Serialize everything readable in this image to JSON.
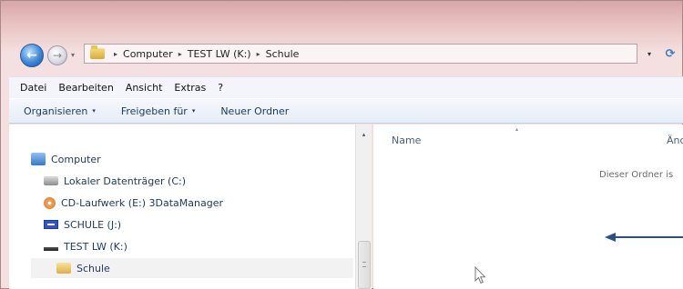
{
  "navigation": {
    "back_label": "←",
    "forward_label": "→",
    "recent_label": "▾",
    "refresh_label": "⟳",
    "dropdown_label": "▾",
    "path": [
      "Computer",
      "TEST LW (K:)",
      "Schule"
    ],
    "separator": "▸"
  },
  "menu": {
    "items": [
      "Datei",
      "Bearbeiten",
      "Ansicht",
      "Extras",
      "?"
    ]
  },
  "commands": {
    "organize": "Organisieren",
    "share": "Freigeben für",
    "new_folder": "Neuer Ordner",
    "caret": "▾"
  },
  "tree": {
    "computer": "Computer",
    "local_disk": "Lokaler Datenträger (C:)",
    "cd_drive": "CD-Laufwerk (E:) 3DataManager",
    "schule_drive": "SCHULE (J:)",
    "test_drive": "TEST LW (K:)",
    "schule_folder": "Schule"
  },
  "content": {
    "col_name": "Name",
    "col_date": "Änd",
    "empty_message": "Dieser Ordner is",
    "sort_indicator": "▴"
  },
  "scrollbar": {
    "up_label": "▴"
  },
  "colors": {
    "accent": "#1e395b",
    "arrow": "#2e4f86"
  }
}
